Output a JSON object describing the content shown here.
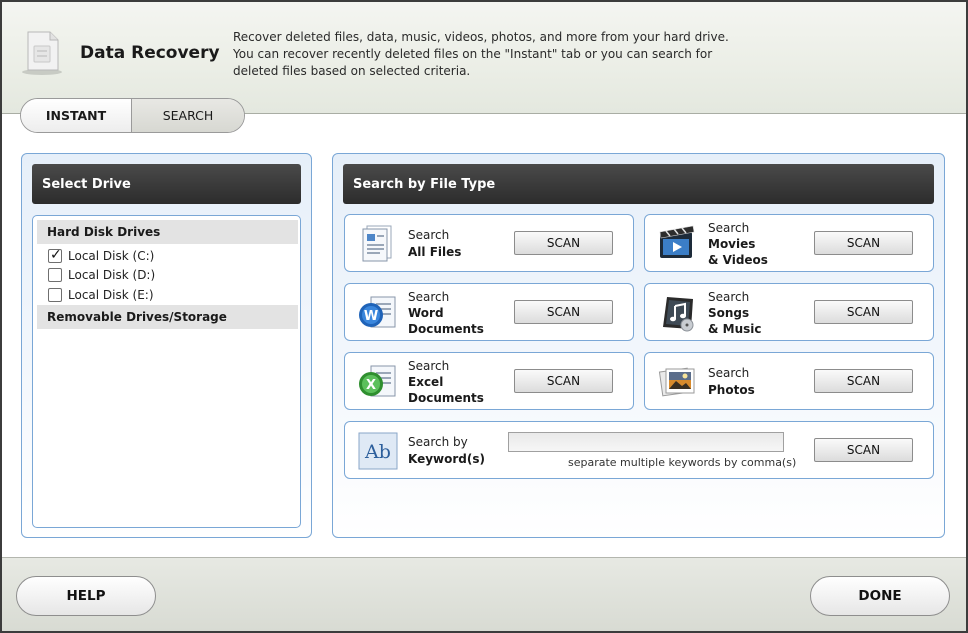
{
  "header": {
    "title": "Data Recovery",
    "description": "Recover deleted files, data, music, videos, photos, and more from your hard drive. You can recover recently deleted files on the \"Instant\" tab or you can search for deleted files based on selected criteria."
  },
  "tabs": [
    {
      "label": "INSTANT"
    },
    {
      "label": "SEARCH",
      "selected": true
    }
  ],
  "drive_panel": {
    "title": "Select Drive",
    "groups": [
      {
        "label": "Hard Disk Drives",
        "items": [
          {
            "label": "Local Disk (C:)",
            "checked": true
          },
          {
            "label": "Local Disk (D:)",
            "checked": false
          },
          {
            "label": "Local Disk (E:)",
            "checked": false
          }
        ]
      },
      {
        "label": "Removable Drives/Storage",
        "items": []
      }
    ]
  },
  "filetype_panel": {
    "title": "Search by File Type",
    "cards": [
      {
        "prefix": "Search",
        "lines": [
          "All Files"
        ],
        "icon": "all-files-icon",
        "button": "SCAN"
      },
      {
        "prefix": "Search",
        "lines": [
          "Movies",
          "& Videos"
        ],
        "icon": "movies-icon",
        "button": "SCAN"
      },
      {
        "prefix": "Search",
        "lines": [
          "Word",
          "Documents"
        ],
        "icon": "word-document-icon",
        "button": "SCAN"
      },
      {
        "prefix": "Search",
        "lines": [
          "Songs",
          "& Music"
        ],
        "icon": "music-icon",
        "button": "SCAN"
      },
      {
        "prefix": "Search",
        "lines": [
          "Excel",
          "Documents"
        ],
        "icon": "excel-document-icon",
        "button": "SCAN"
      },
      {
        "prefix": "Search",
        "lines": [
          "Photos"
        ],
        "icon": "photos-icon",
        "button": "SCAN"
      }
    ],
    "keyword": {
      "prefix": "Search by",
      "label": "Keyword(s)",
      "value": "",
      "hint": "separate multiple keywords by comma(s)",
      "button": "SCAN",
      "icon": "keyword-icon",
      "icon_text": "Ab"
    }
  },
  "footer": {
    "help": "HELP",
    "done": "DONE"
  },
  "colors": {
    "panel_border": "#7aa7d6",
    "header_bar": "#333333"
  }
}
